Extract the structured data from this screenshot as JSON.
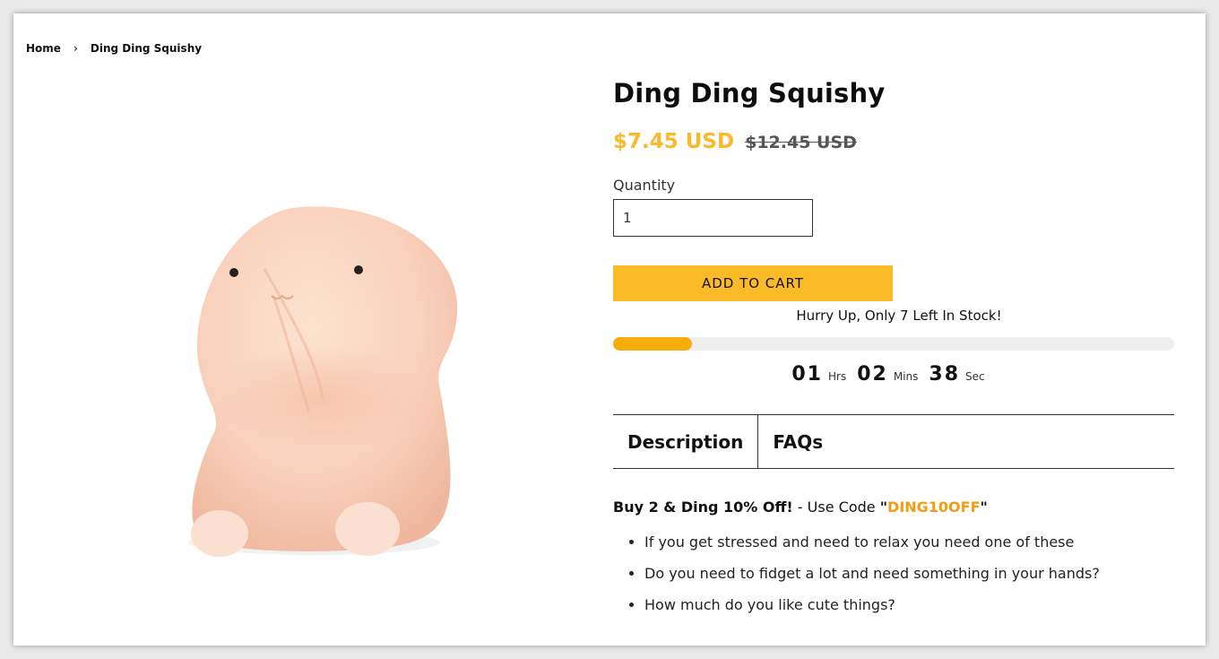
{
  "breadcrumb": {
    "home": "Home",
    "separator": "›",
    "current": "Ding Ding Squishy"
  },
  "product": {
    "title": "Ding Ding Squishy",
    "price": "$7.45 USD",
    "compare_price": "$12.45 USD",
    "image_alt": "squishy-toy-image"
  },
  "quantity": {
    "label": "Quantity",
    "value": "1"
  },
  "cart": {
    "add_label": "ADD TO CART"
  },
  "stock": {
    "text": "Hurry Up, Only 7  Left In Stock!",
    "progress_fraction": 0.14
  },
  "timer": {
    "hours": "01",
    "hours_unit": "Hrs",
    "mins": "02",
    "mins_unit": "Mins",
    "secs": "38",
    "secs_unit": "Sec"
  },
  "tabs": [
    {
      "label": "Description"
    },
    {
      "label": "FAQs"
    }
  ],
  "description": {
    "promo_bold": "Buy 2 & Ding 10% Off!",
    "promo_text": " - Use Code ",
    "promo_code": "DING10OFF",
    "features": [
      "If you get stressed and need to relax you need one of these",
      "Do you need to fidget a lot and need something in your hands?",
      "How much do you like cute things?"
    ]
  },
  "colors": {
    "accent": "#fbb829",
    "button": "#fbbb29",
    "progress": "#f5ad0f",
    "code": "#f39c12"
  }
}
